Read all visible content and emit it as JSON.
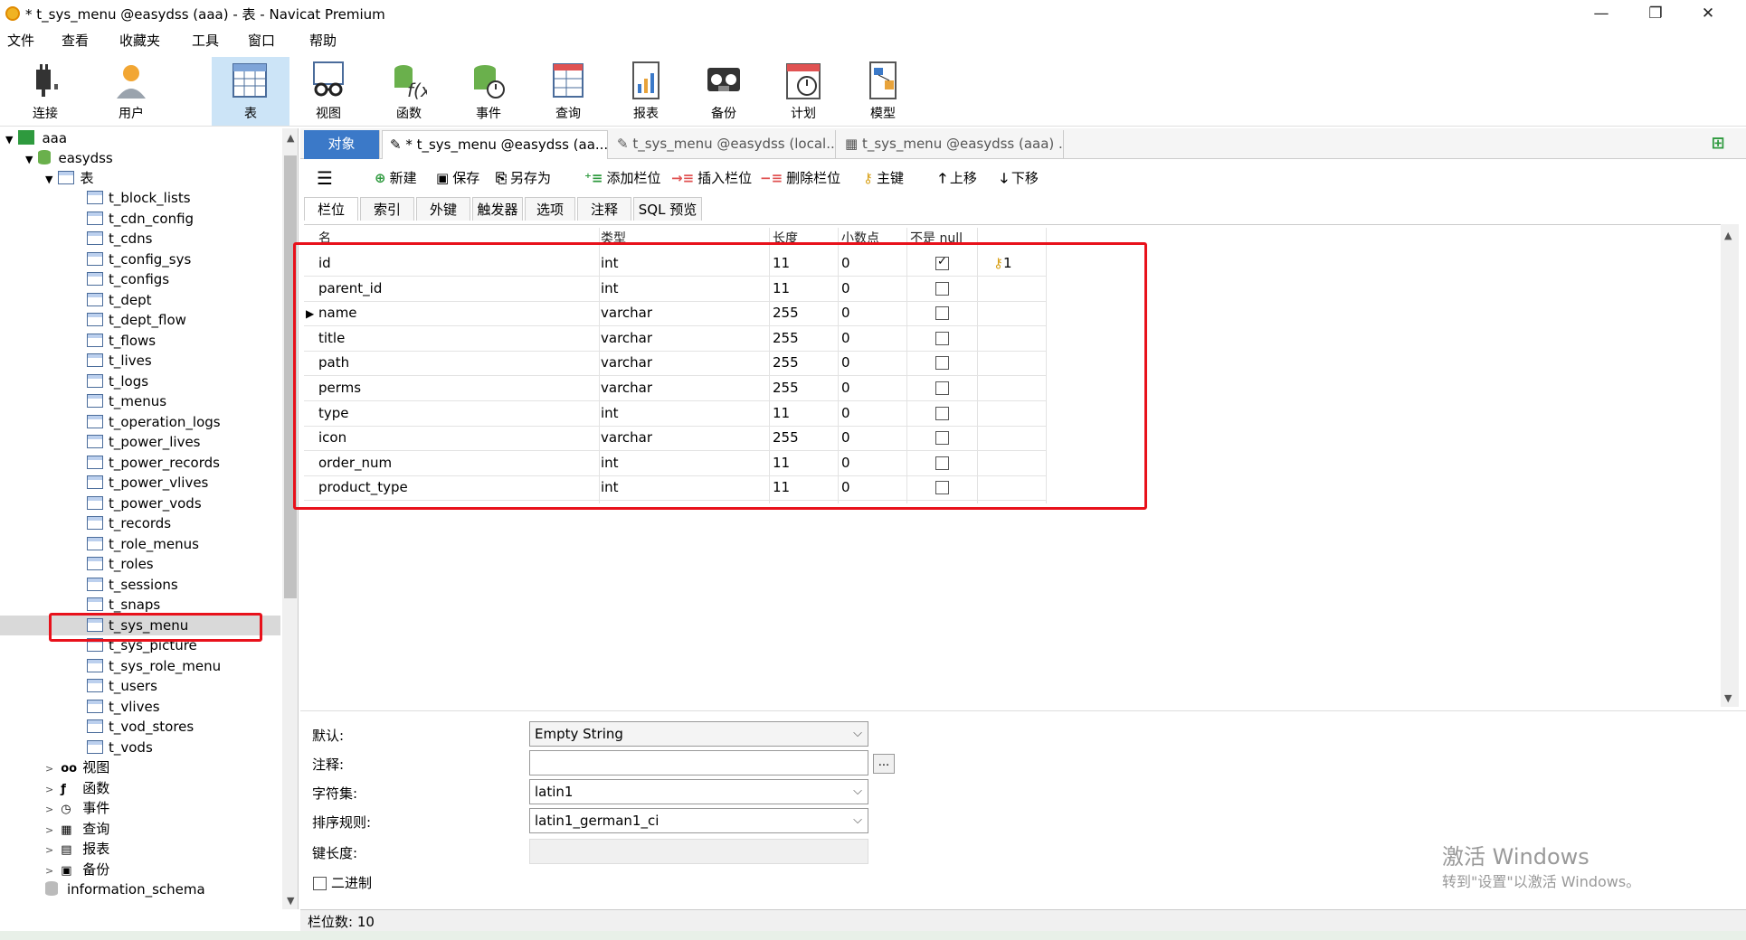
{
  "window": {
    "title": "* t_sys_menu @easydss (aaa) - 表 - Navicat Premium",
    "minimize": "—",
    "maximize": "❐",
    "close": "✕"
  },
  "menu": [
    "文件",
    "查看",
    "收藏夹",
    "工具",
    "窗口",
    "帮助"
  ],
  "toolbar": [
    {
      "label": "连接",
      "icon": "plug-icon"
    },
    {
      "label": "用户",
      "icon": "user-icon"
    },
    {
      "label": "表",
      "icon": "table-icon"
    },
    {
      "label": "视图",
      "icon": "glasses-icon"
    },
    {
      "label": "函数",
      "icon": "function-icon"
    },
    {
      "label": "事件",
      "icon": "event-icon"
    },
    {
      "label": "查询",
      "icon": "query-icon"
    },
    {
      "label": "报表",
      "icon": "report-icon"
    },
    {
      "label": "备份",
      "icon": "backup-icon"
    },
    {
      "label": "计划",
      "icon": "schedule-icon"
    },
    {
      "label": "模型",
      "icon": "model-icon"
    }
  ],
  "tree": {
    "connection": "aaa",
    "database": "easydss",
    "tables_group": "表",
    "tables": [
      "t_block_lists",
      "t_cdn_config",
      "t_cdns",
      "t_config_sys",
      "t_configs",
      "t_dept",
      "t_dept_flow",
      "t_flows",
      "t_lives",
      "t_logs",
      "t_menus",
      "t_operation_logs",
      "t_power_lives",
      "t_power_records",
      "t_power_vlives",
      "t_power_vods",
      "t_records",
      "t_role_menus",
      "t_roles",
      "t_sessions",
      "t_snaps",
      "t_sys_menu",
      "t_sys_picture",
      "t_sys_role_menu",
      "t_users",
      "t_vlives",
      "t_vod_stores",
      "t_vods"
    ],
    "selected": "t_sys_menu",
    "groups": [
      "视图",
      "函数",
      "事件",
      "查询",
      "报表",
      "备份"
    ],
    "other_db": "information_schema"
  },
  "tabs": [
    {
      "label": "对象"
    },
    {
      "label": "* t_sys_menu @easydss (aa..."
    },
    {
      "label": "t_sys_menu @easydss (local..."
    },
    {
      "label": "t_sys_menu @easydss (aaa) ..."
    }
  ],
  "editor_toolbar": {
    "menu": "☰",
    "new": "新建",
    "save": "保存",
    "save_as": "另存为",
    "add_col": "添加栏位",
    "insert_col": "插入栏位",
    "delete_col": "删除栏位",
    "primary_key": "主键",
    "move_up": "上移",
    "move_down": "下移"
  },
  "subtabs": [
    "栏位",
    "索引",
    "外键",
    "触发器",
    "选项",
    "注释",
    "SQL 预览"
  ],
  "grid": {
    "headers": [
      "名",
      "类型",
      "长度",
      "小数点",
      "不是 null",
      ""
    ],
    "rows": [
      {
        "name": "id",
        "type": "int",
        "length": "11",
        "decimals": "0",
        "not_null": true,
        "key": "1"
      },
      {
        "name": "parent_id",
        "type": "int",
        "length": "11",
        "decimals": "0",
        "not_null": false,
        "key": ""
      },
      {
        "name": "name",
        "type": "varchar",
        "length": "255",
        "decimals": "0",
        "not_null": false,
        "key": ""
      },
      {
        "name": "title",
        "type": "varchar",
        "length": "255",
        "decimals": "0",
        "not_null": false,
        "key": ""
      },
      {
        "name": "path",
        "type": "varchar",
        "length": "255",
        "decimals": "0",
        "not_null": false,
        "key": ""
      },
      {
        "name": "perms",
        "type": "varchar",
        "length": "255",
        "decimals": "0",
        "not_null": false,
        "key": ""
      },
      {
        "name": "type",
        "type": "int",
        "length": "11",
        "decimals": "0",
        "not_null": false,
        "key": ""
      },
      {
        "name": "icon",
        "type": "varchar",
        "length": "255",
        "decimals": "0",
        "not_null": false,
        "key": ""
      },
      {
        "name": "order_num",
        "type": "int",
        "length": "11",
        "decimals": "0",
        "not_null": false,
        "key": ""
      },
      {
        "name": "product_type",
        "type": "int",
        "length": "11",
        "decimals": "0",
        "not_null": false,
        "key": ""
      }
    ]
  },
  "properties": {
    "default_label": "默认:",
    "default_value": "Empty String",
    "comment_label": "注释:",
    "comment_btn": "...",
    "charset_label": "字符集:",
    "charset_value": "latin1",
    "collation_label": "排序规则:",
    "collation_value": "latin1_german1_ci",
    "keylen_label": "键长度:",
    "binary_label": "二进制"
  },
  "status": {
    "field_count": "栏位数: 10"
  },
  "watermark": {
    "line1": "激活 Windows",
    "line2": "转到\"设置\"以激活 Windows。"
  },
  "colors": {
    "accent": "#3b79c8",
    "highlight": "#e8111b",
    "selection": "#cce4f7"
  }
}
